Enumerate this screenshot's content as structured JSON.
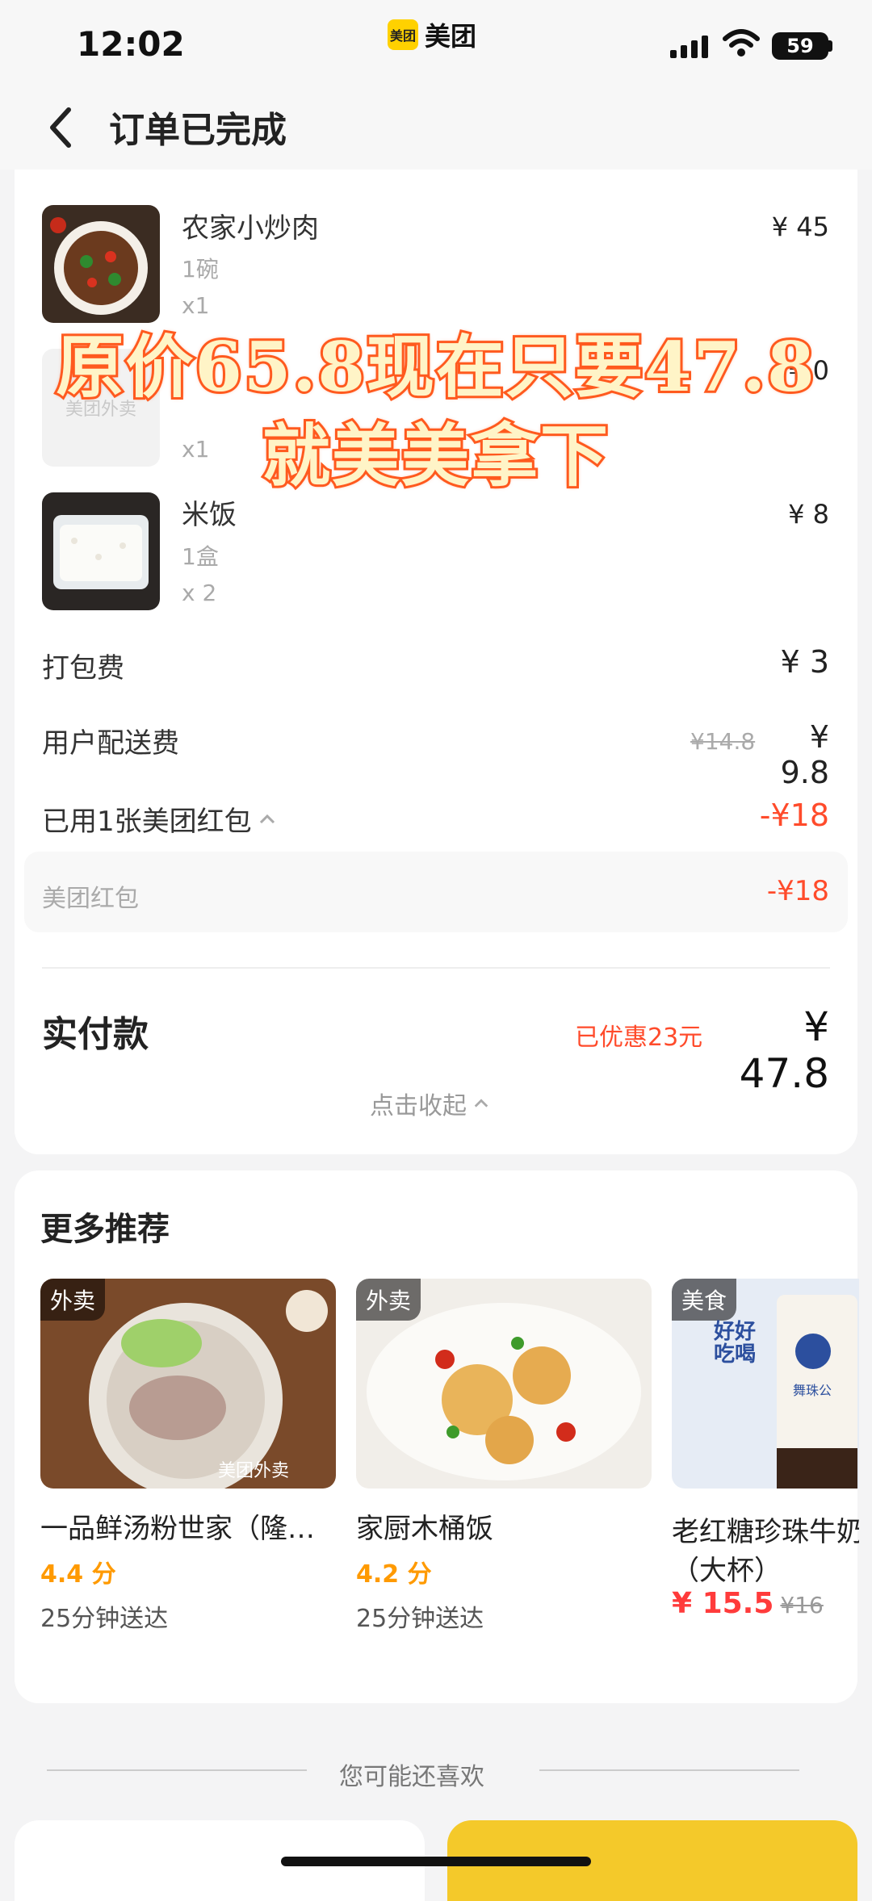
{
  "status_bar": {
    "time": "12:02",
    "app_brand": "美团",
    "app_logo_text": "美团",
    "battery": "59"
  },
  "header": {
    "title": "订单已完成"
  },
  "order_items": [
    {
      "name": "农家小炒肉",
      "unit": "1碗",
      "qty": "x1",
      "price": "¥ 45"
    },
    {
      "name": "",
      "unit": "",
      "qty": "x1",
      "price": "¥ 0",
      "placeholder": "美团外卖"
    },
    {
      "name": "米饭",
      "unit": "1盒",
      "qty": "x 2",
      "price": "¥ 8"
    }
  ],
  "fees": {
    "packing_label": "打包费",
    "packing_value": "¥ 3",
    "delivery_label": "用户配送费",
    "delivery_original": "¥14.8",
    "delivery_value": "¥ 9.8",
    "coupon_label": "已用1张美团红包",
    "coupon_value": "-¥18",
    "coupon_sub_label": "美团红包",
    "coupon_sub_value": "-¥18"
  },
  "total": {
    "label": "实付款",
    "discount": "已优惠23元",
    "value": "¥ 47.8",
    "collapse": "点击收起"
  },
  "overlay_caption": {
    "line1": "原价65.8现在只要47.8",
    "line2": "就美美拿下"
  },
  "recommendations": {
    "title": "更多推荐",
    "items": [
      {
        "tag": "外卖",
        "name": "一品鲜汤粉世家（隆…",
        "rating": "4.4 分",
        "delivery": "25分钟送达",
        "watermark": "美团外卖"
      },
      {
        "tag": "外卖",
        "name": "家厨木桶饭",
        "rating": "4.2 分",
        "delivery": "25分钟送达"
      },
      {
        "tag": "美食",
        "name": "老红糖珍珠牛奶",
        "name2": "（大杯）",
        "price": "¥ 15.5",
        "original": "¥16",
        "img_text": "好好吃喝",
        "brand": "舞珠公"
      }
    ]
  },
  "guess": {
    "label": "您可能还喜欢"
  },
  "colors": {
    "accent_red": "#ff4b2b",
    "rating_orange": "#ff9a00",
    "brand_yellow": "#ffd100"
  }
}
